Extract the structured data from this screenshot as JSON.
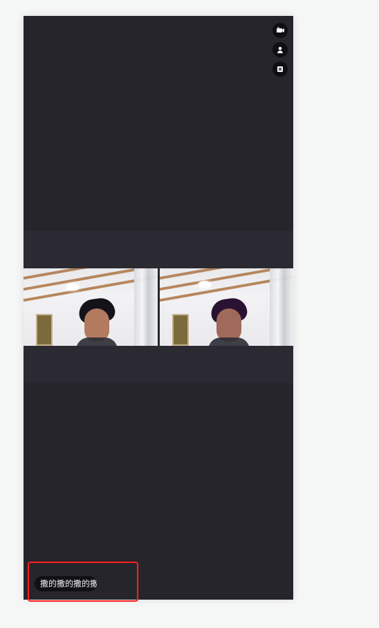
{
  "screen": {
    "side_controls": [
      {
        "icon": "switch-camera-icon"
      },
      {
        "icon": "user-icon"
      },
      {
        "icon": "close-icon"
      }
    ],
    "caption": {
      "text": "撒的撒的撒的撒"
    },
    "colors": {
      "page_bg": "#f5f6f6",
      "phone_bg": "#26252b",
      "band_bg": "#2b2a33",
      "caption_bg": "#111114",
      "highlight_border": "#ff1f1f"
    }
  }
}
